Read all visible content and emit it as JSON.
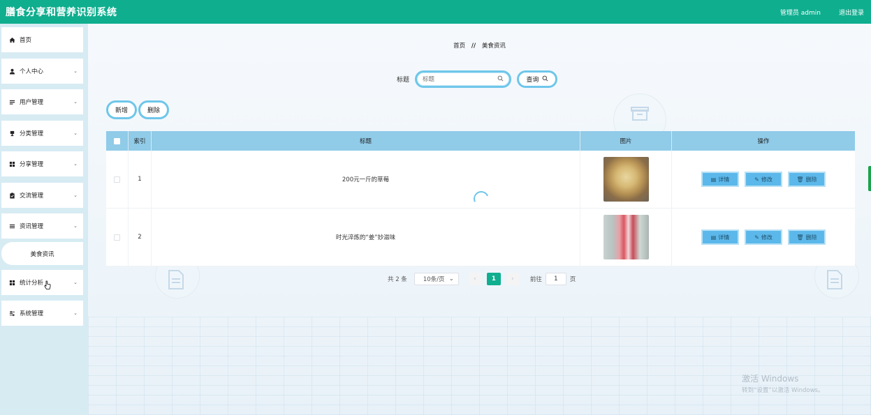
{
  "header": {
    "title": "膳食分享和营养识别系统",
    "admin_label": "管理员 admin",
    "logout_label": "退出登录"
  },
  "sidebar": {
    "items": [
      {
        "label": "首页",
        "icon": "home-icon",
        "chevron": false
      },
      {
        "label": "个人中心",
        "icon": "person-icon",
        "chevron": true
      },
      {
        "label": "用户管理",
        "icon": "list-icon",
        "chevron": true
      },
      {
        "label": "分类管理",
        "icon": "trophy-icon",
        "chevron": true
      },
      {
        "label": "分享管理",
        "icon": "grid-icon",
        "chevron": true
      },
      {
        "label": "交流管理",
        "icon": "clipboard-icon",
        "chevron": true
      },
      {
        "label": "资讯管理",
        "icon": "menu-icon",
        "chevron": true
      },
      {
        "label": "统计分析",
        "icon": "grid-icon",
        "chevron": true
      },
      {
        "label": "系统管理",
        "icon": "sliders-icon",
        "chevron": true
      }
    ],
    "submenu": {
      "label": "美食资讯"
    }
  },
  "breadcrumb": {
    "home": "首页",
    "separator": "//",
    "current": "美食资讯"
  },
  "search": {
    "label": "标题",
    "placeholder": "标题",
    "button_label": "查询"
  },
  "actions": {
    "add_label": "新增",
    "delete_label": "删除"
  },
  "table": {
    "headers": {
      "index": "索引",
      "title": "标题",
      "image": "图片",
      "operations": "操作"
    },
    "rows": [
      {
        "index": "1",
        "title": "200元一斤的草莓",
        "image": "food-photo"
      },
      {
        "index": "2",
        "title": "时光淬炼的“姜”妙滋味",
        "image": "drink-photo"
      }
    ],
    "op_labels": {
      "detail": "详情",
      "edit": "修改",
      "delete": "删除"
    }
  },
  "pagination": {
    "total": "共 2 条",
    "page_size": "10条/页",
    "current_page": "1",
    "goto_prefix": "前往",
    "goto_value": "1",
    "goto_suffix": "页"
  },
  "watermark": {
    "line1": "激活 Windows",
    "line2": "转到“设置”以激活 Windows。"
  },
  "colors": {
    "header": "#0fae8f",
    "table_header": "#90cbe8",
    "op_button": "#5cb8ea",
    "sidebar": "#d7ebf3"
  }
}
